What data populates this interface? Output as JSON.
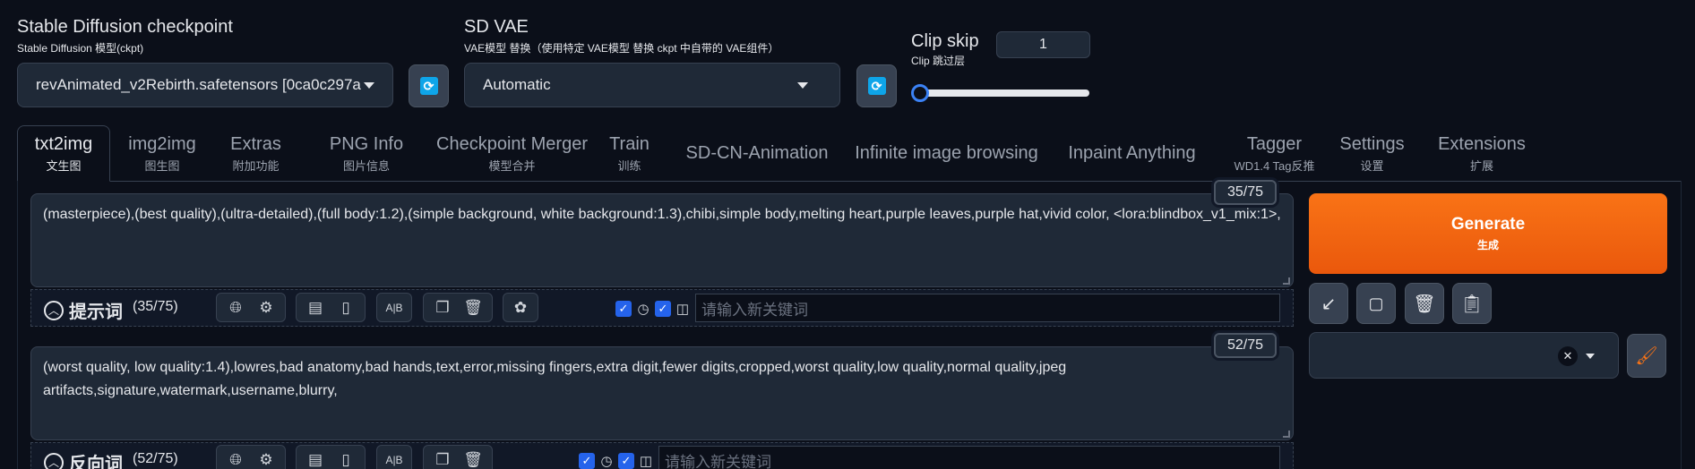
{
  "checkpoint": {
    "label": "Stable Diffusion checkpoint",
    "sublabel": "Stable Diffusion 模型(ckpt)",
    "value": "revAnimated_v2Rebirth.safetensors [0ca0c297a"
  },
  "vae": {
    "label": "SD VAE",
    "sublabel": "VAE模型 替换（使用特定 VAE模型 替换 ckpt 中自带的 VAE组件）",
    "value": "Automatic"
  },
  "clip_skip": {
    "label": "Clip skip",
    "sublabel": "Clip 跳过层",
    "value": "1",
    "slider_fraction": 0.0
  },
  "tabs": [
    {
      "label": "txt2img",
      "sub": "文生图",
      "active": true
    },
    {
      "label": "img2img",
      "sub": "图生图"
    },
    {
      "label": "Extras",
      "sub": "附加功能"
    },
    {
      "label": "PNG Info",
      "sub": "图片信息"
    },
    {
      "label": "Checkpoint Merger",
      "sub": "模型合并"
    },
    {
      "label": "Train",
      "sub": "训练"
    },
    {
      "label": "SD-CN-Animation",
      "sub": ""
    },
    {
      "label": "Infinite image browsing",
      "sub": ""
    },
    {
      "label": "Inpaint Anything",
      "sub": ""
    },
    {
      "label": "Tagger",
      "sub": "WD1.4 Tag反推"
    },
    {
      "label": "Settings",
      "sub": "设置"
    },
    {
      "label": "Extensions",
      "sub": "扩展"
    }
  ],
  "prompt": {
    "counter": "35/75",
    "text": "(masterpiece),(best quality),(ultra-detailed),(full body:1.2),(simple background, white background:1.3),chibi,simple body,melting heart,purple leaves,purple hat,vivid color, <lora:blindbox_v1_mix:1>,",
    "toolbar_label": "提示词",
    "toolbar_count": "(35/75)",
    "keyword_placeholder": "请输入新关键词"
  },
  "negative": {
    "counter": "52/75",
    "text": "(worst quality, low quality:1.4),lowres,bad anatomy,bad hands,text,error,missing fingers,extra digit,fewer digits,cropped,worst quality,low quality,normal quality,jpeg artifacts,signature,watermark,username,blurry,",
    "toolbar_label": "反向词",
    "toolbar_count": "(52/75)",
    "keyword_placeholder": "请输入新关键词"
  },
  "generate": {
    "label": "Generate",
    "sub": "生成"
  },
  "icons": {
    "refresh": "refresh-icon",
    "arrow": "arrow-down-left-icon",
    "square": "square-icon",
    "trash": "trash-icon",
    "clipboard": "clipboard-icon",
    "brush": "paintbrush-icon"
  },
  "colors": {
    "accent": "#f97316",
    "background": "#0b0f19",
    "checkbox": "#2563eb"
  }
}
